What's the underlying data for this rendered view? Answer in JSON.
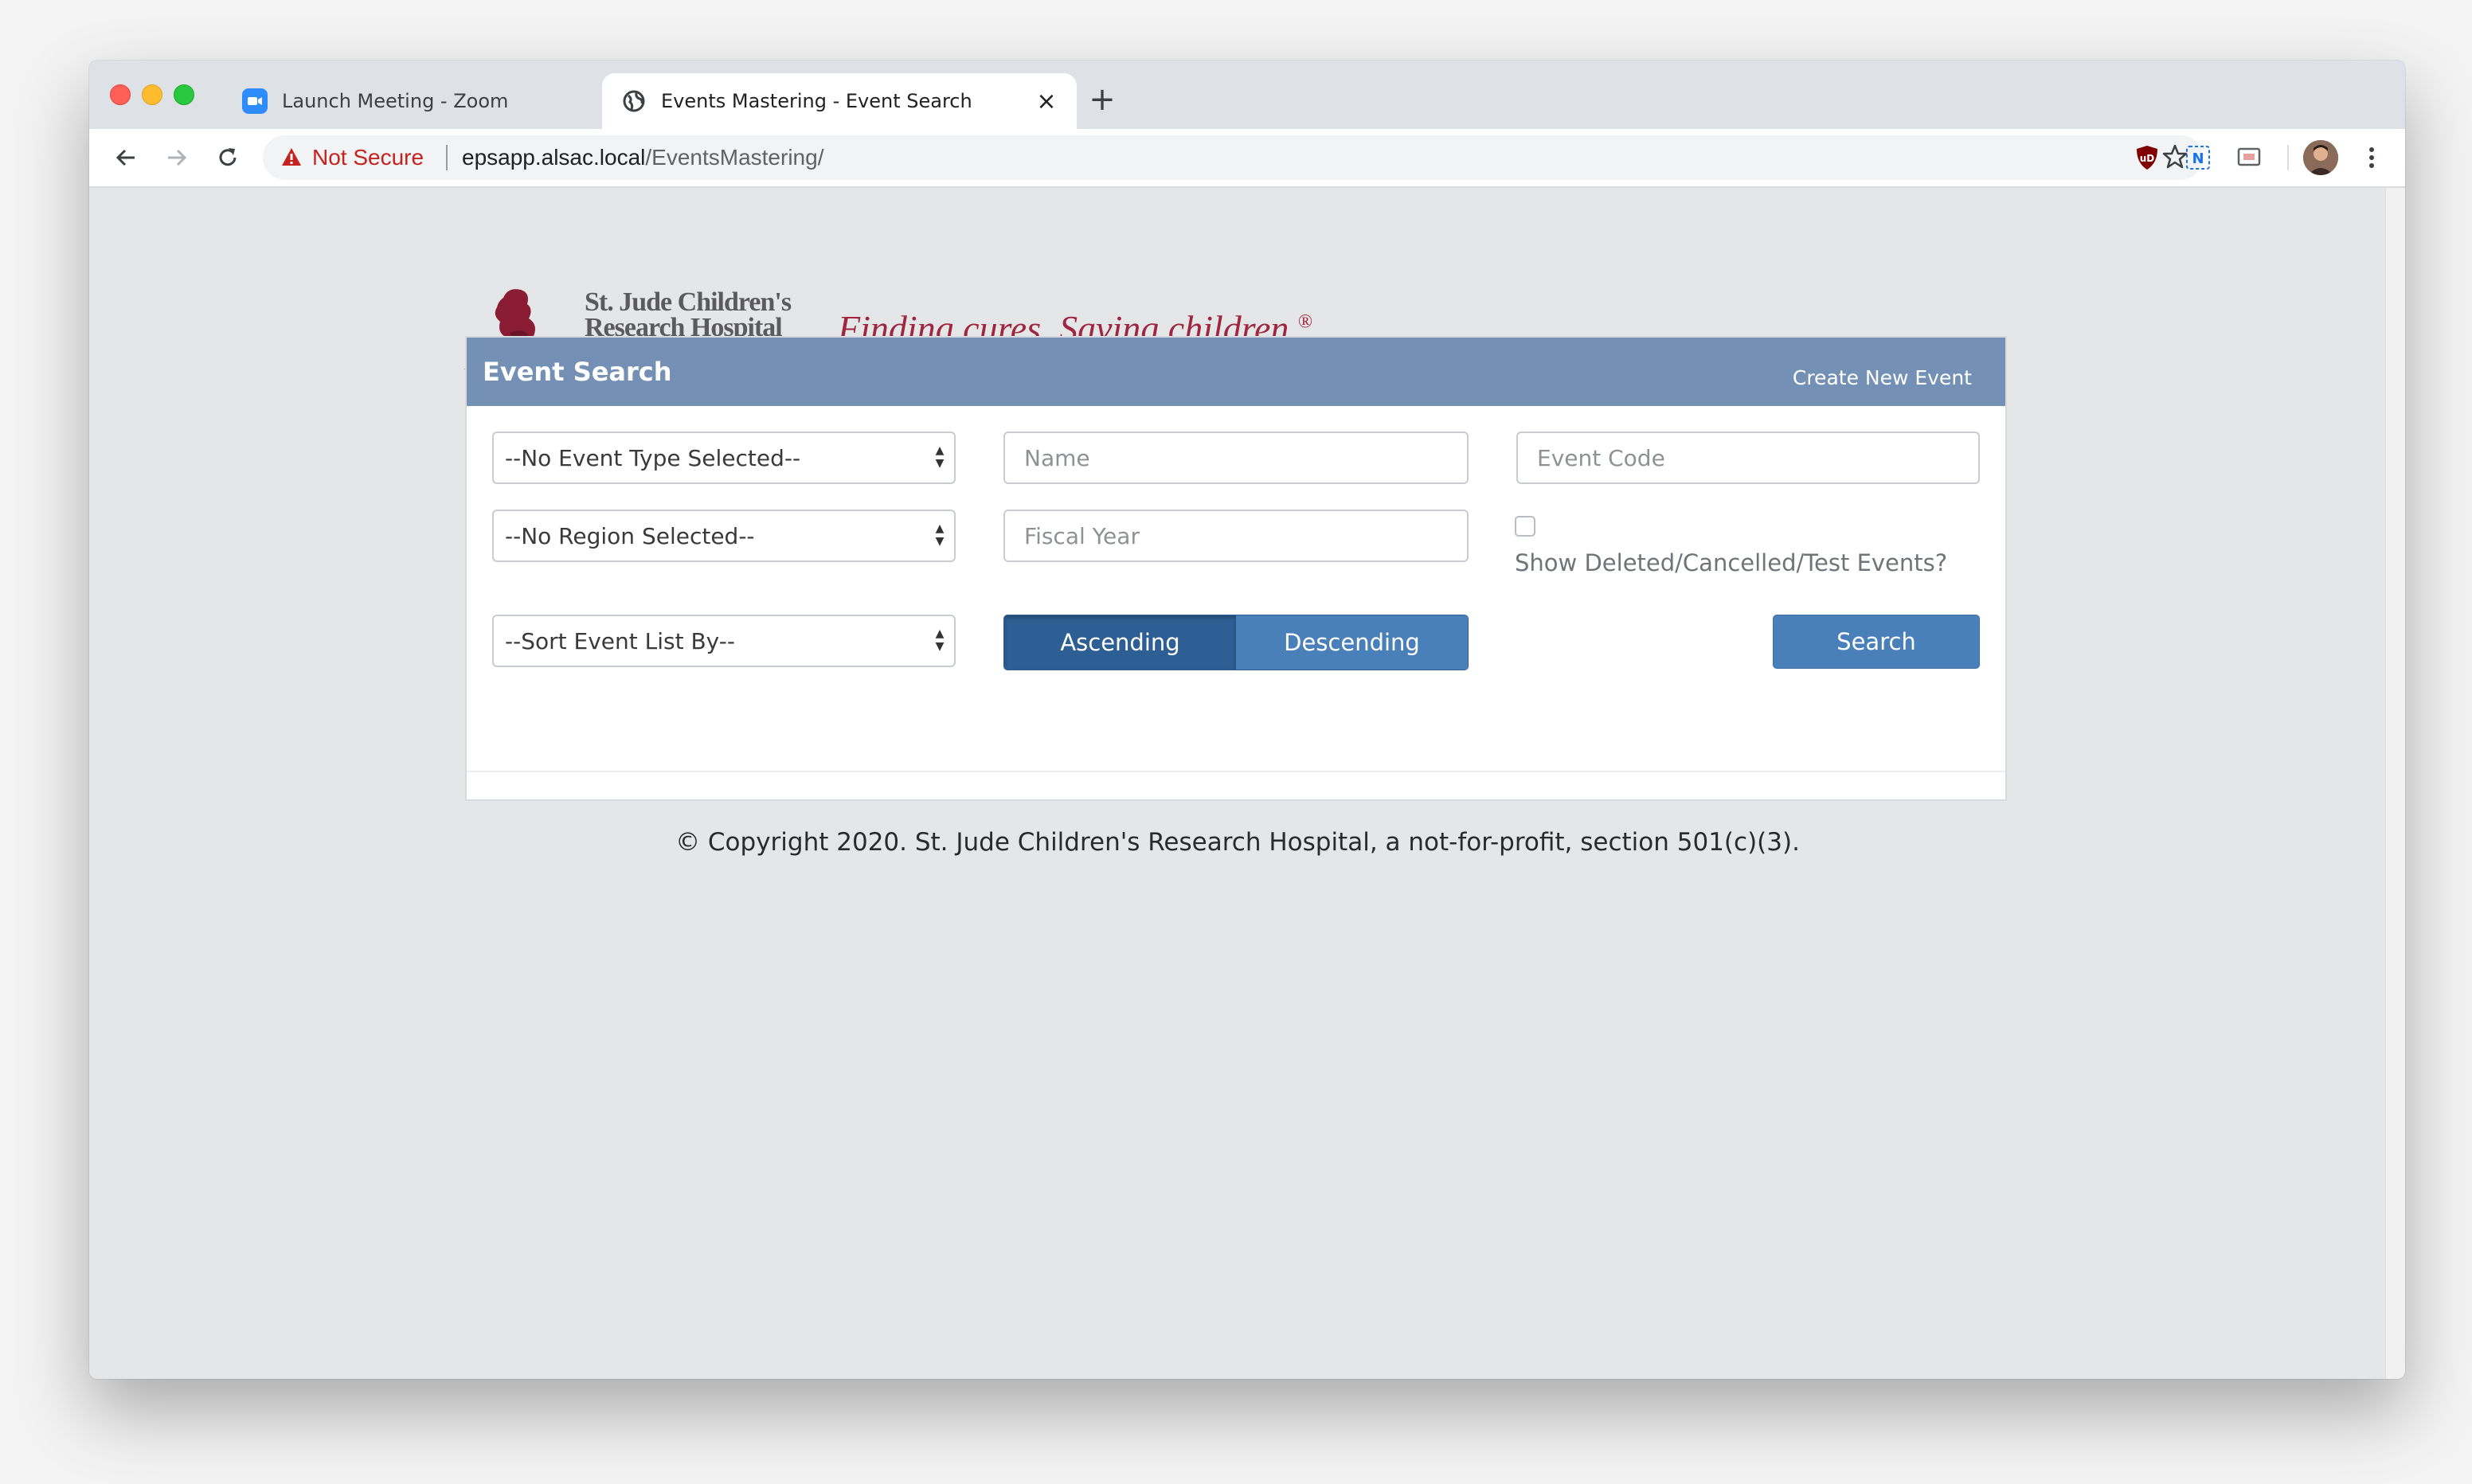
{
  "browser": {
    "tabs": [
      {
        "title": "Launch Meeting - Zoom",
        "icon": "zoom-video-icon"
      },
      {
        "title": "Events Mastering - Event Search",
        "icon": "globe-icon",
        "active": true
      }
    ],
    "security_label": "Not Secure",
    "url_host": "epsapp.alsac.local",
    "url_path": "/EventsMastering/"
  },
  "brand": {
    "logo_line1": "St. Jude Children's",
    "logo_line2": "Research Hospital",
    "tagline": "Finding cures. Saving children.",
    "tagline_mark": "®",
    "color": "#a0253e"
  },
  "panel": {
    "title": "Event Search",
    "create_link": "Create New Event",
    "header_color": "#7491b5"
  },
  "form": {
    "event_type": "--No Event Type Selected--",
    "region": "--No Region Selected--",
    "sort_by": "--Sort Event List By--",
    "name_placeholder": "Name",
    "fiscal_year_placeholder": "Fiscal Year",
    "event_code_placeholder": "Event Code",
    "show_deleted_label": "Show Deleted/Cancelled/Test Events?",
    "show_deleted_checked": false,
    "ascending_label": "Ascending",
    "descending_label": "Descending",
    "sort_order_selected": "Ascending",
    "search_label": "Search"
  },
  "footer": {
    "copyright": "© Copyright 2020. St. Jude Children's Research Hospital, a not-for-profit, section 501(c)(3)."
  }
}
